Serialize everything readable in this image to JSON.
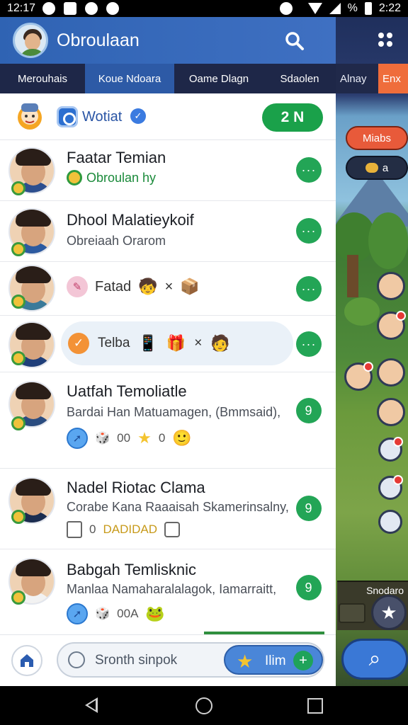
{
  "status": {
    "time": "12:17",
    "battery_text": "%",
    "right_time": "2:22"
  },
  "header": {
    "title": "Obroulaan",
    "search_icon": "search-icon",
    "menu_icon": "grid-menu-icon"
  },
  "tabs": [
    {
      "label": "Merouhais",
      "active": false
    },
    {
      "label": "Koue Ndoara",
      "active": true
    },
    {
      "label": "Oame Dlagn",
      "active": false
    },
    {
      "label": "Sdaolen",
      "active": false
    }
  ],
  "game": {
    "tab_right_1": "Alnay",
    "tab_right_2": "Enx",
    "pill_red": "Miabs",
    "pill_dark": "a",
    "panel_label": "Snodaro"
  },
  "promo": {
    "label": "Wotiat",
    "cta": "2 N"
  },
  "rows": [
    {
      "name": "Faatar Temian",
      "sub": "Obroulan hy",
      "action": "···"
    },
    {
      "name": "Dhool Malatieykoif",
      "sub": "Obreiaah Orarom",
      "action": "···"
    },
    {
      "name": "",
      "inline_text": "Fatad",
      "inline_extra": "×",
      "action": "···"
    },
    {
      "name": "",
      "bubble_text": "Telba",
      "bubble_extra": "×",
      "action": "···"
    },
    {
      "name": "Uatfah Temoliatle",
      "sub": "Bardai Han Matuamagen, (Bmmsaid),",
      "meta_text": "00",
      "meta_text2": "0",
      "action": "9"
    },
    {
      "name": "Nadel Riotac Clama",
      "sub": "Corabe Kana Raaaisah Skamerinsalny,",
      "meta_text": "0",
      "meta_text2": "DADIDAD",
      "action": "9"
    },
    {
      "name": "Babgah Temlisknic",
      "sub": "Manlaa Namaharalalagok, Iamarraitt,",
      "meta_text": "00A",
      "action": "9"
    }
  ],
  "bottom": {
    "search_placeholder": "Sronth sinpok",
    "pill_text": "Ilim"
  }
}
